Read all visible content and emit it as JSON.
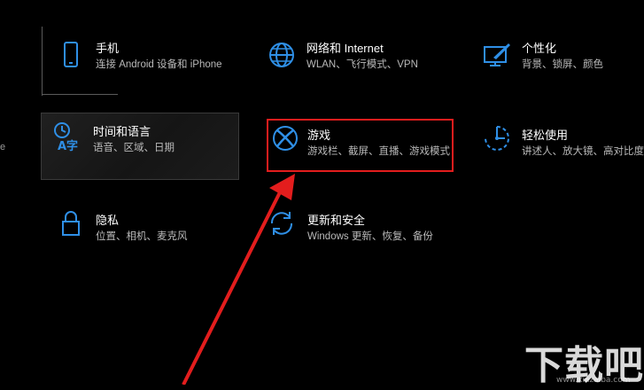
{
  "colors": {
    "icon": "#2f8fe6",
    "highlight": "#e31d1d",
    "arrow": "#e31d1d",
    "text": "#ffffff",
    "subtext": "#b9b9b9"
  },
  "left_fragment": "e",
  "tiles": [
    {
      "id": "phone",
      "icon": "phone-icon",
      "title": "手机",
      "desc": "连接 Android 设备和 iPhone"
    },
    {
      "id": "network",
      "icon": "globe-icon",
      "title": "网络和 Internet",
      "desc": "WLAN、飞行模式、VPN"
    },
    {
      "id": "personalization",
      "icon": "paintbrush-monitor-icon",
      "title": "个性化",
      "desc": "背景、锁屏、颜色"
    },
    {
      "id": "time-language",
      "icon": "time-language-icon",
      "title": "时间和语言",
      "desc": "语音、区域、日期"
    },
    {
      "id": "gaming",
      "icon": "xbox-icon",
      "title": "游戏",
      "desc": "游戏栏、截屏、直播、游戏模式"
    },
    {
      "id": "ease-of-access",
      "icon": "ease-of-access-icon",
      "title": "轻松使用",
      "desc": "讲述人、放大镜、高对比度"
    },
    {
      "id": "privacy",
      "icon": "lock-icon",
      "title": "隐私",
      "desc": "位置、相机、麦克风"
    },
    {
      "id": "update-security",
      "icon": "sync-icon",
      "title": "更新和安全",
      "desc": "Windows 更新、恢复、备份"
    }
  ],
  "watermark": {
    "logo": "下载吧",
    "url": "www.xiazaiba.com"
  }
}
